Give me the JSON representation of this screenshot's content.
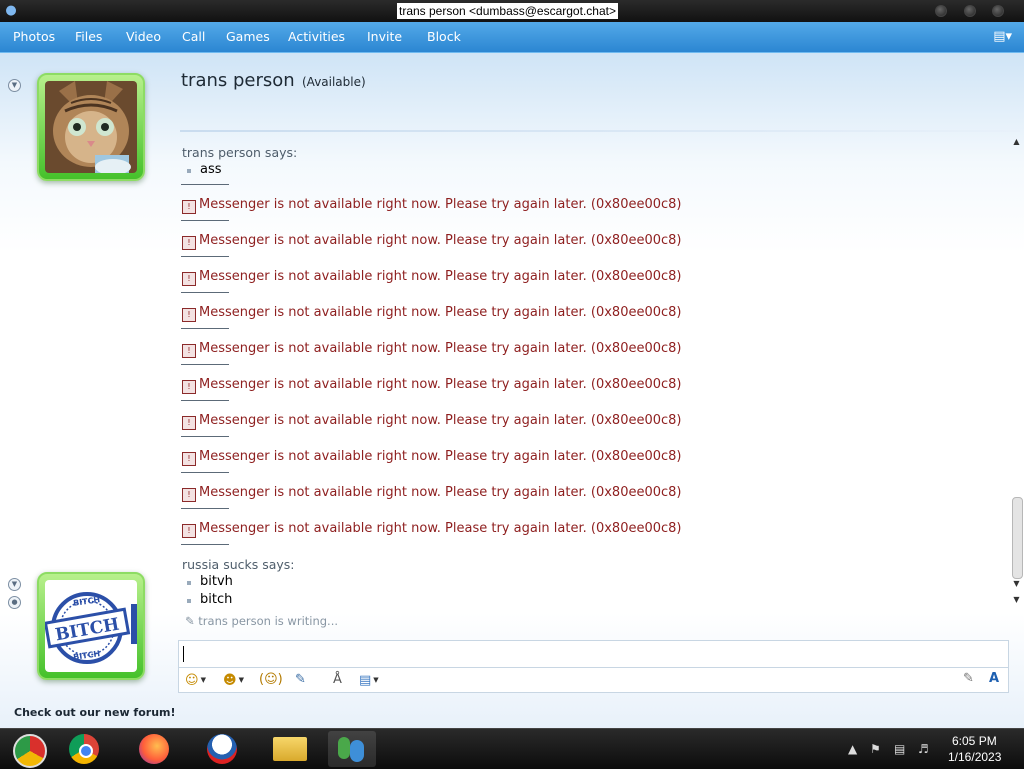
{
  "window": {
    "title": "trans person <dumbass@escargot.chat>"
  },
  "menu": [
    "Photos",
    "Files",
    "Video",
    "Call",
    "Games",
    "Activities",
    "Invite",
    "Block"
  ],
  "contact": {
    "name": "trans person",
    "status": "(Available)"
  },
  "conversation": {
    "first_sender": "trans person says:",
    "first_message": "ass",
    "error_text": "Messenger is not available right now. Please try again later. (0x80ee00c8)",
    "second_sender": "russia sucks says:",
    "second_messages": [
      "bitvh",
      "bitch"
    ],
    "typing": "trans person is writing..."
  },
  "self_avatar": {
    "stamp_top": "BITCH",
    "stamp_main": "BITCH",
    "stamp_bottom": "BITCH"
  },
  "footer": {
    "forum_link": "Check out our new forum!"
  },
  "taskbar": {
    "time": "6:05 PM",
    "date": "1/16/2023"
  },
  "colors": {
    "accent": "#2b86d2",
    "error": "#8e1f1f",
    "avatar_frame": "#45c12b"
  }
}
